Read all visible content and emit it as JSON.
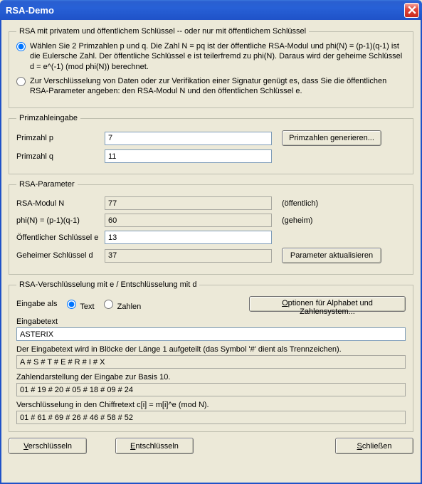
{
  "titlebar": {
    "title": "RSA-Demo"
  },
  "group1": {
    "legend": "RSA mit privatem und öffentlichem Schlüssel -- oder nur mit öffentlichem Schlüssel",
    "opt1": "Wählen Sie 2 Primzahlen p und q. Die Zahl N = pq ist der öffentliche RSA-Modul und phi(N) = (p-1)(q-1) ist die Eulersche Zahl. Der öffentliche Schlüssel e ist teilerfremd zu phi(N). Daraus wird der geheime Schlüssel d = e^(-1) (mod  phi(N)) berechnet.",
    "opt2": "Zur Verschlüsselung von Daten oder zur Verifikation einer Signatur genügt es, dass Sie die öffentlichen RSA-Parameter angeben: den RSA-Modul N und den öffentlichen Schlüssel e."
  },
  "primes": {
    "legend": "Primzahleingabe",
    "p_label": "Primzahl p",
    "p_value": "7",
    "q_label": "Primzahl q",
    "q_value": "11",
    "gen_btn": "Primzahlen generieren..."
  },
  "params": {
    "legend": "RSA-Parameter",
    "n_label": "RSA-Modul N",
    "n_value": "77",
    "n_side": "(öffentlich)",
    "phi_label": "phi(N) = (p-1)(q-1)",
    "phi_value": "60",
    "phi_side": "(geheim)",
    "e_label": "Öffentlicher Schlüssel e",
    "e_value": "13",
    "d_label": "Geheimer Schlüssel d",
    "d_value": "37",
    "upd_btn": "Parameter aktualisieren"
  },
  "enc": {
    "legend": "RSA-Verschlüsselung mit e / Entschlüsselung mit d",
    "input_as": "Eingabe als",
    "radio_text": "Text",
    "radio_num": "Zahlen",
    "opts_btn": "Optionen für Alphabet und Zahlensystem...",
    "eingabetext_lbl": "Eingabetext",
    "eingabetext_val": "ASTERIX",
    "blocks_lbl": "Der Eingabetext wird in Blöcke der Länge 1 aufgeteilt (das Symbol '#' dient als Trennzeichen).",
    "blocks_val": "A # S # T # E # R # I # X",
    "base_lbl": "Zahlendarstellung der Eingabe zur Basis 10.",
    "base_val": "01 # 19 # 20 # 05 # 18 # 09 # 24",
    "cipher_lbl": "Verschlüsselung in den Chiffretext  c[i] = m[i]^e (mod N).",
    "cipher_val": "01 # 61 # 69 # 26 # 46 # 58 # 52"
  },
  "bottom": {
    "encrypt": "Verschlüsseln",
    "decrypt": "Entschlüsseln",
    "close": "Schließen"
  }
}
